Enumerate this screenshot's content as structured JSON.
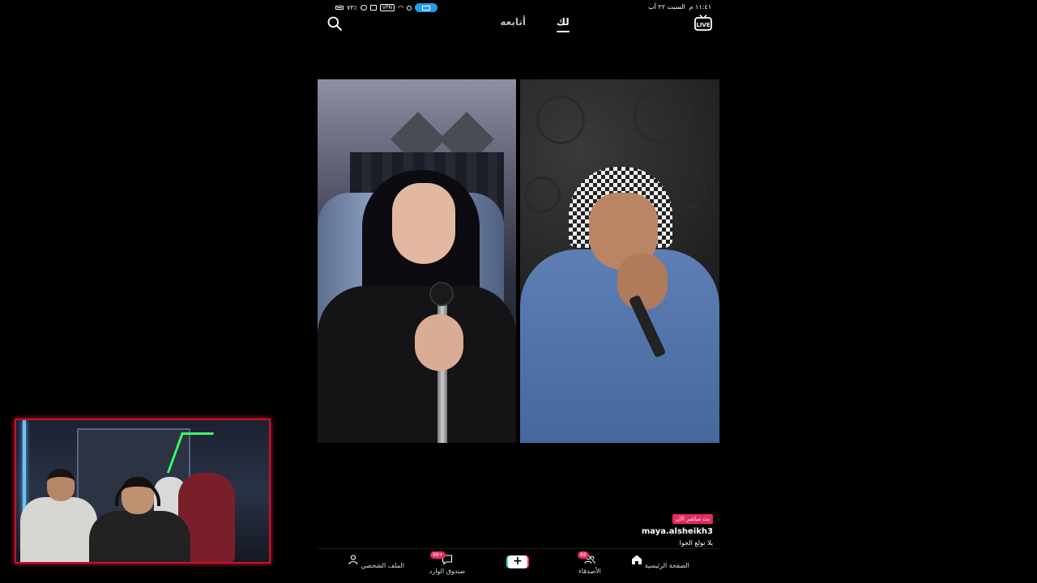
{
  "status_bar": {
    "time": "١١:٤١ م",
    "date": "السبت ٢٢ آب",
    "battery": "٧٣٪",
    "vpn_label": "VPN"
  },
  "top_nav": {
    "tabs": [
      {
        "label": "لك",
        "active": true
      },
      {
        "label": "أتابعه",
        "active": false
      }
    ],
    "live_label": "LIVE"
  },
  "live_overlay": {
    "badge": "بث مباشر الآن",
    "username": "maya.alsheikh3",
    "caption": "يلا تولع الجوا"
  },
  "bottom_nav": {
    "items": [
      {
        "label": "الصفحة الرئيسية",
        "icon": "home-icon"
      },
      {
        "label": "الأصدقاء",
        "icon": "friends-icon",
        "badge": "88"
      },
      {
        "label": "+",
        "icon": "plus-icon"
      },
      {
        "label": "صندوق الوارد",
        "icon": "inbox-icon",
        "badge": "99+"
      },
      {
        "label": "الملف الشخصي",
        "icon": "profile-icon"
      }
    ]
  },
  "colors": {
    "accent": "#e8295f",
    "status_pill": "#2b9ae8",
    "webcam_border": "#c4142a"
  }
}
